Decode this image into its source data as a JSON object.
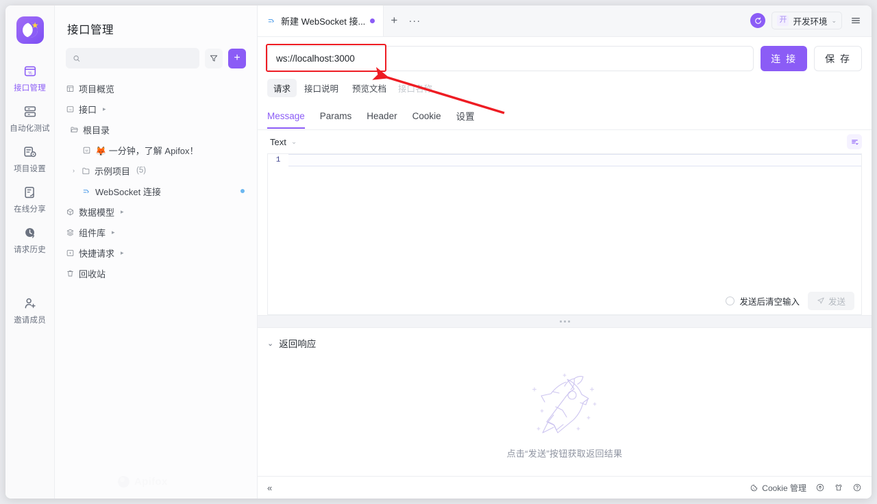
{
  "rail": {
    "logo_name": "apifox-logo",
    "items": [
      {
        "label": "接口管理",
        "icon": "api-management-icon",
        "active": true
      },
      {
        "label": "自动化测试",
        "icon": "automation-test-icon",
        "active": false
      },
      {
        "label": "项目设置",
        "icon": "project-settings-icon",
        "active": false
      },
      {
        "label": "在线分享",
        "icon": "online-share-icon",
        "active": false
      },
      {
        "label": "请求历史",
        "icon": "request-history-icon",
        "active": false
      },
      {
        "label": "邀请成员",
        "icon": "invite-member-icon",
        "active": false
      }
    ]
  },
  "sidebar": {
    "title": "接口管理",
    "search_placeholder": "",
    "search_value": "",
    "filter_icon": "filter-icon",
    "add_label": "+",
    "tree": [
      {
        "label": "项目概览",
        "icon": "overview-icon",
        "indent": 0,
        "caret": "",
        "count": "",
        "more": false,
        "dot": false
      },
      {
        "label": "接口",
        "icon": "api-icon",
        "indent": 0,
        "caret": "",
        "count": "",
        "more": true,
        "dot": false
      },
      {
        "label": "根目录",
        "icon": "folder-open-icon",
        "indent": 1,
        "caret": "",
        "count": "",
        "more": false,
        "dot": false
      },
      {
        "label": "🦊 一分钟，了解 Apifox！",
        "icon": "markdown-doc-icon",
        "indent": 2,
        "caret": "",
        "count": "",
        "more": false,
        "dot": false
      },
      {
        "label": "示例项目",
        "icon": "folder-icon",
        "indent": 1,
        "caret": "›",
        "count": "(5)",
        "more": false,
        "dot": false
      },
      {
        "label": "WebSocket 连接",
        "icon": "websocket-icon",
        "indent": 2,
        "caret": "",
        "count": "",
        "more": false,
        "dot": true
      },
      {
        "label": "数据模型",
        "icon": "data-model-icon",
        "indent": 0,
        "caret": "",
        "count": "",
        "more": true,
        "dot": false
      },
      {
        "label": "组件库",
        "icon": "component-library-icon",
        "indent": 0,
        "caret": "",
        "count": "",
        "more": true,
        "dot": false
      },
      {
        "label": "快捷请求",
        "icon": "quick-request-icon",
        "indent": 0,
        "caret": "",
        "count": "",
        "more": true,
        "dot": false
      },
      {
        "label": "回收站",
        "icon": "trash-icon",
        "indent": 0,
        "caret": "",
        "count": "",
        "more": false,
        "dot": false
      }
    ],
    "watermark": "Apifox"
  },
  "tabbar": {
    "tab_title": "新建 WebSocket 接...",
    "tab_icon": "websocket-icon",
    "new_tab_label": "+",
    "more_tabs_label": "···",
    "sync_icon": "sync-icon",
    "env_badge": "开",
    "env_label": "开发环境",
    "env_caret": "⌄",
    "menu_icon": "hamburger-menu-icon"
  },
  "request": {
    "url_value": "ws://localhost:3000",
    "url_placeholder": "",
    "connect_label": "连 接",
    "save_label": "保 存",
    "pills": [
      {
        "label": "请求",
        "active": true
      },
      {
        "label": "接口说明",
        "active": false
      },
      {
        "label": "预览文档",
        "active": false
      }
    ],
    "api_name_placeholder": "接口名称",
    "section_tabs": [
      {
        "label": "Message",
        "active": true
      },
      {
        "label": "Params",
        "active": false
      },
      {
        "label": "Header",
        "active": false
      },
      {
        "label": "Cookie",
        "active": false
      },
      {
        "label": "设置",
        "active": false
      }
    ],
    "format_label": "Text",
    "format_caret": "⌄",
    "beautify_icon": "format-beautify-icon",
    "line_number": "1",
    "message_value": "",
    "clear_after_send_label": "发送后清空输入",
    "send_label": "发送",
    "send_icon": "send-plane-icon"
  },
  "response": {
    "title": "返回响应",
    "caret": "⌄",
    "empty_hint": "点击“发送”按钮获取返回结果",
    "illustration": "rocket-illustration"
  },
  "footer": {
    "collapse_label": "«",
    "cookie_label": "Cookie 管理",
    "cookie_icon": "cookie-icon",
    "upload_icon": "upload-circle-icon",
    "shirt_icon": "theme-shirt-icon",
    "help_icon": "help-circle-icon"
  },
  "annotation": {
    "highlight_color": "#ee1c23",
    "arrow_color": "#ee1c23",
    "target": "url-input"
  },
  "colors": {
    "accent": "#8b5cf6",
    "tab_active_text": "#8b5cf6",
    "border": "#eceef1",
    "text": "#1f2328",
    "muted": "#9aa0a8"
  }
}
